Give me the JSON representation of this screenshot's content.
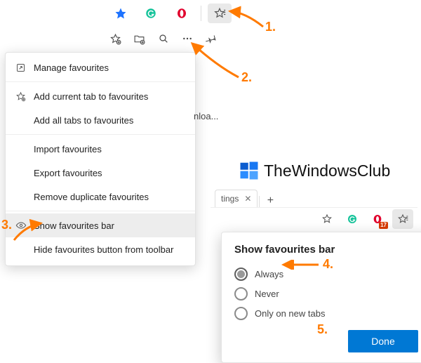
{
  "topbar": {
    "icons": [
      "star-icon",
      "grammarly-icon",
      "opera-icon",
      "collections-icon"
    ],
    "active_index": 3
  },
  "fav_strip": {
    "buttons": [
      "add-fav-icon",
      "add-folder-icon",
      "search-icon",
      "more-icon",
      "pin-icon"
    ]
  },
  "menu": {
    "items": [
      {
        "icon": "open-icon",
        "label": "Manage favourites"
      },
      {
        "sep": true
      },
      {
        "icon": "add-star-icon",
        "label": "Add current tab to favourites"
      },
      {
        "icon": "",
        "label": "Add all tabs to favourites"
      },
      {
        "sep": true
      },
      {
        "icon": "",
        "label": "Import favourites"
      },
      {
        "icon": "",
        "label": "Export favourites"
      },
      {
        "icon": "",
        "label": "Remove duplicate favourites"
      },
      {
        "sep": true
      },
      {
        "icon": "eye-icon",
        "label": "Show favourites bar",
        "hover": true
      },
      {
        "icon": "",
        "label": "Hide favourites button from toolbar"
      }
    ]
  },
  "background_text": "nloa...",
  "win2": {
    "tab_label": "tings",
    "add_tab": "+",
    "toolbar_icons": [
      "fav-star-icon",
      "grammarly-icon",
      "opera-badge-icon",
      "collections-icon"
    ],
    "badge": "17"
  },
  "popup": {
    "title": "Show favourites bar",
    "options": [
      "Always",
      "Never",
      "Only on new tabs"
    ],
    "selected_index": 0,
    "done": "Done"
  },
  "watermark": {
    "text": "TheWindowsClub"
  },
  "annotations": {
    "n1": "1.",
    "n2": "2.",
    "n3": "3.",
    "n4": "4.",
    "n5": "5."
  }
}
